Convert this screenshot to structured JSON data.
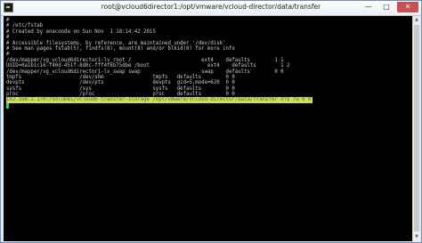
{
  "window": {
    "title": "root@vcloud6director1:/opt/vmware/vcloud-director/data/transfer",
    "minimize_glyph": "—",
    "maximize_glyph": "□",
    "close_glyph": "✕"
  },
  "terminal": {
    "lines": [
      "#",
      "# /etc/fstab",
      "# Created by anaconda on Sun Nov  1 18:14:42 2015",
      "#",
      "# Accessible filesystems, by reference, are maintained under '/dev/disk'",
      "# See man pages fstab(5), findfs(8), mount(8) and/or blkid(8) for more info",
      "#",
      "/dev/mapper/vg_vcloud6director1-lv_root /                       ext4    defaults        1 1",
      "UUID=0a1b1c16-f40d-451f-8d0c-fff4f6b75dbe /boot                   ext4    defaults        1 2",
      "/dev/mapper/vg_vcloud6director1-lv_swap swap                    swap    defaults        0 0",
      "tmpfs                   /dev/shm                tmpfs   defaults        0 0",
      "devpts                  /dev/pts                devpts  gid=5,mode=620  0 0",
      "sysfs                   /sys                    sysfs   defaults        0 0",
      "proc                    /proc                   proc    defaults        0 0"
    ],
    "highlighted_line": "192.168.2.170:/volume1/vcloud6-transfer-storage /opt/vmware/vcloud-director/data/transfer nfs rw 0 0",
    "colors": {
      "background": "#000000",
      "text": "#c8c8c8",
      "highlight_bg": "#c8e34a",
      "highlight_text": "#5a4f92",
      "cursor": "#2ad860"
    }
  },
  "scrollbar": {
    "up_glyph": "▲",
    "down_glyph": "▼"
  }
}
